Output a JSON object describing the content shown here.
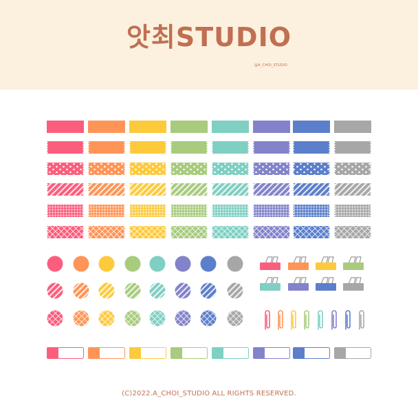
{
  "brand": {
    "title": "앗최STUDIO",
    "handle": "@A_CHOI_STUDIO"
  },
  "footer": {
    "copyright": "(C)2022.A_CHOI_STUDIO ALL RIGHTS RESERVED."
  },
  "palette": [
    {
      "name": "pink",
      "color": "#fb5e7d"
    },
    {
      "name": "orange",
      "color": "#fe9557"
    },
    {
      "name": "yellow",
      "color": "#fdca3c"
    },
    {
      "name": "green",
      "color": "#a8cb7e"
    },
    {
      "name": "mint",
      "color": "#7fcfc2"
    },
    {
      "name": "purple",
      "color": "#8383cb"
    },
    {
      "name": "blue",
      "color": "#5c7fcb"
    },
    {
      "name": "gray",
      "color": "#a7a7a7"
    }
  ],
  "tape_styles": [
    "plain",
    "wavy-edge",
    "dots",
    "stripes",
    "grid",
    "cross-hatch"
  ],
  "circle_styles": [
    "plain",
    "stripes",
    "grid"
  ],
  "sticker_groups": [
    "washi-tape",
    "round-stickers",
    "binder-clips",
    "paper-clips",
    "tab-labels"
  ],
  "binder_clip_colors": [
    "pink",
    "orange",
    "yellow",
    "green",
    "mint",
    "purple",
    "blue",
    "gray"
  ],
  "paper_clip_colors": [
    "pink",
    "orange",
    "yellow",
    "green",
    "mint",
    "purple",
    "blue",
    "gray"
  ]
}
